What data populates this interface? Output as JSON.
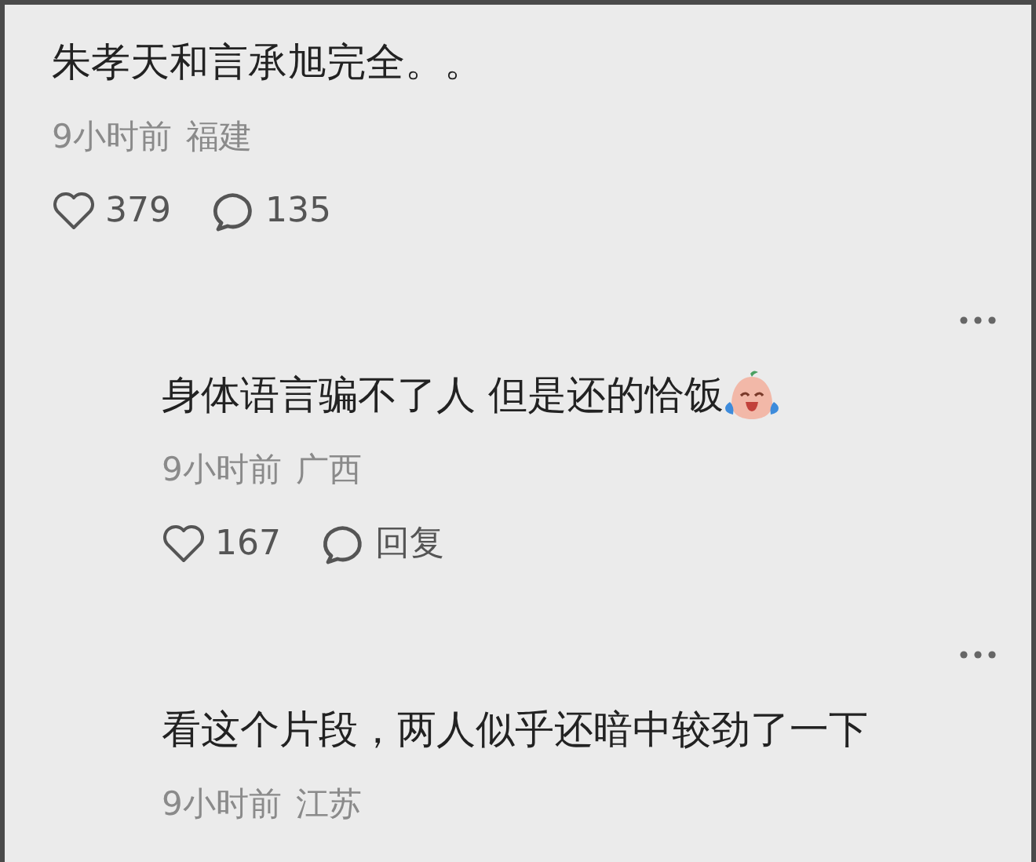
{
  "comment": {
    "text": "朱孝天和言承旭完全。。",
    "time": "9小时前",
    "location": "福建",
    "likes": "379",
    "reply": "135",
    "replies": [
      {
        "text": "身体语言骗不了人 但是还的恰饭",
        "emoji": true,
        "time": "9小时前",
        "location": "广西",
        "likes": "167",
        "reply": "回复"
      },
      {
        "text": "看这个片段，两人似乎还暗中较劲了一下",
        "time": "9小时前",
        "location": "江苏"
      }
    ]
  }
}
